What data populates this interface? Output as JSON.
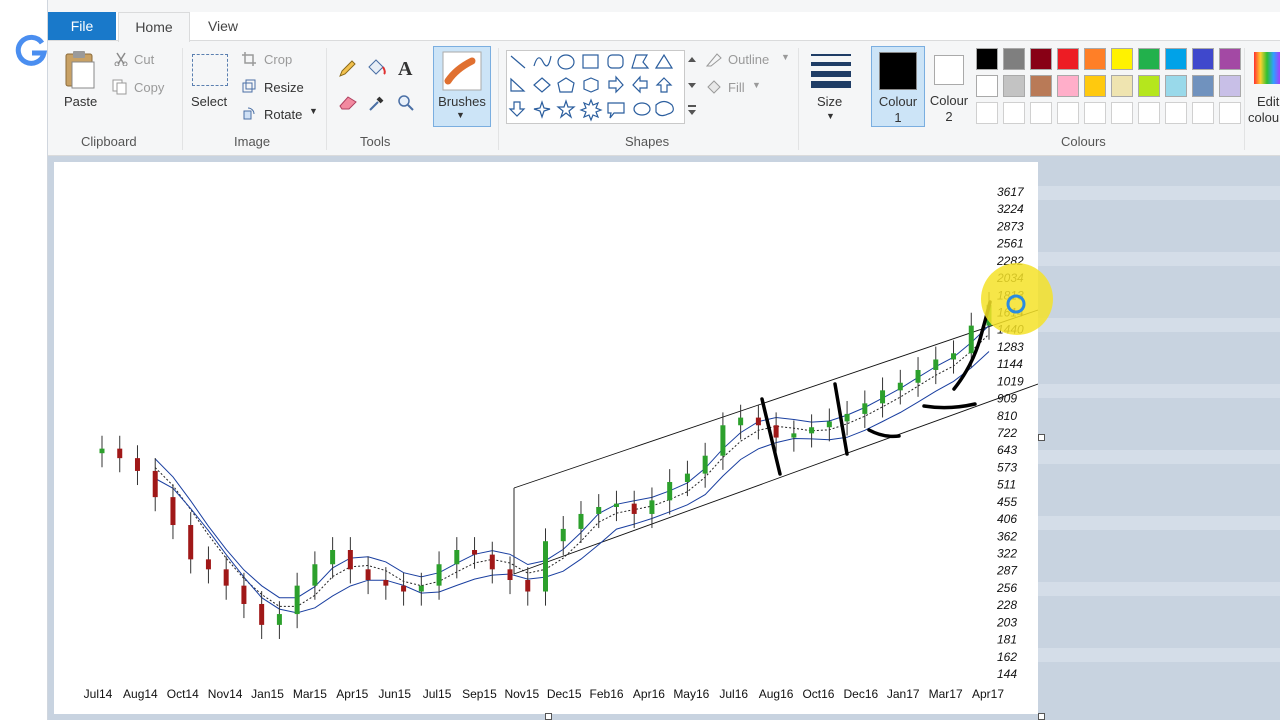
{
  "tabs": {
    "file": "File",
    "home": "Home",
    "view": "View"
  },
  "clipboard": {
    "paste": "Paste",
    "cut": "Cut",
    "copy": "Copy",
    "group": "Clipboard"
  },
  "image": {
    "select": "Select",
    "crop": "Crop",
    "resize": "Resize",
    "rotate": "Rotate",
    "group": "Image"
  },
  "tools": {
    "group": "Tools"
  },
  "brushes": {
    "label": "Brushes"
  },
  "shapes": {
    "outline": "Outline",
    "fill": "Fill",
    "group": "Shapes"
  },
  "size": {
    "label": "Size"
  },
  "colour1": {
    "label": "Colour",
    "num": "1"
  },
  "colour2": {
    "label": "Colour",
    "num": "2"
  },
  "colours": {
    "group": "Colours",
    "edit": "Edit",
    "edit2": "colours",
    "row1": [
      "#000000",
      "#7f7f7f",
      "#880015",
      "#ed1c24",
      "#ff7f27",
      "#fff200",
      "#22b14c",
      "#00a2e8",
      "#3f48cc",
      "#a349a4"
    ],
    "row2": [
      "#ffffff",
      "#c3c3c3",
      "#b97a57",
      "#ffaec9",
      "#ffc90e",
      "#efe4b0",
      "#b5e61d",
      "#99d9ea",
      "#7092be",
      "#c8bfe7"
    ]
  },
  "chart_data": {
    "type": "candlestick",
    "x_labels": [
      "Jul14",
      "Aug14",
      "Oct14",
      "Nov14",
      "Jan15",
      "Mar15",
      "Apr15",
      "Jun15",
      "Jul15",
      "Sep15",
      "Nov15",
      "Dec15",
      "Feb16",
      "Apr16",
      "May16",
      "Jul16",
      "Aug16",
      "Oct16",
      "Dec16",
      "Jan17",
      "Mar17",
      "Apr17"
    ],
    "y_labels": [
      "3617",
      "3224",
      "2873",
      "2561",
      "2282",
      "2034",
      "1813",
      "1614",
      "1440",
      "1283",
      "1144",
      "1019",
      "909",
      "810",
      "722",
      "643",
      "573",
      "511",
      "455",
      "406",
      "362",
      "322",
      "287",
      "256",
      "228",
      "203",
      "181",
      "162",
      "144"
    ],
    "scale": "log",
    "y_range": [
      144,
      3617
    ],
    "close": [
      650,
      610,
      560,
      470,
      390,
      310,
      290,
      260,
      230,
      200,
      215,
      260,
      300,
      330,
      290,
      270,
      260,
      250,
      260,
      300,
      330,
      320,
      290,
      270,
      250,
      350,
      380,
      420,
      440,
      450,
      420,
      460,
      520,
      550,
      620,
      760,
      800,
      760,
      700,
      720,
      750,
      780,
      820,
      880,
      960,
      1010,
      1100,
      1180,
      1230,
      1480,
      1700
    ]
  }
}
